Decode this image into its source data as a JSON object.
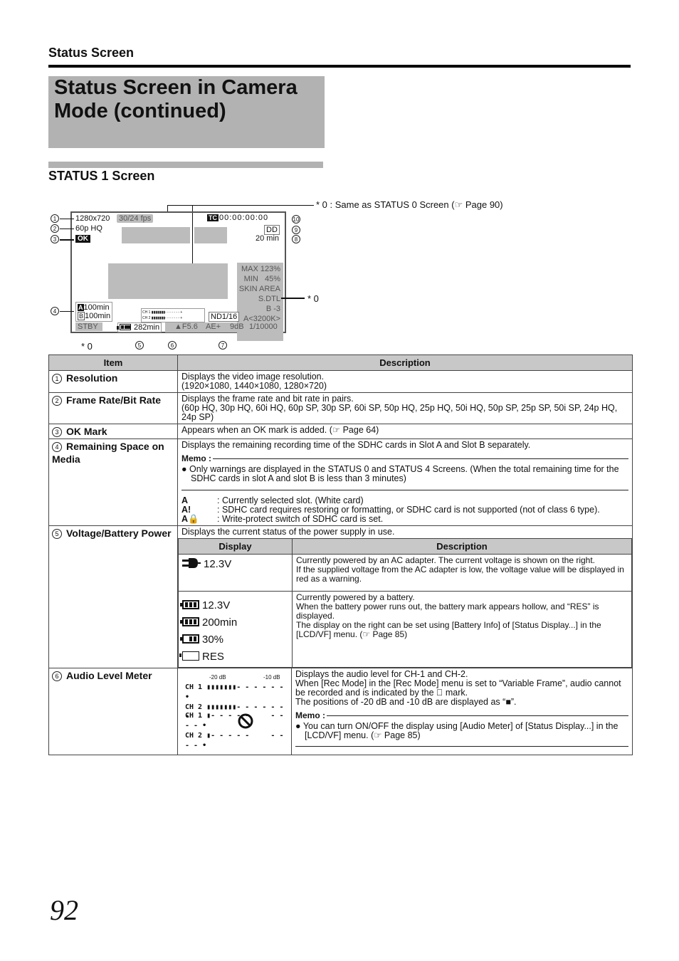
{
  "header": {
    "section": "Status Screen",
    "title": "Status Screen in Camera Mode (continued)",
    "subtitle": "STATUS 1 Screen"
  },
  "diagram": {
    "note": "* 0 : Same as STATUS 0 Screen (☞ Page 90)",
    "star0": "* 0",
    "resolution": "1280x720",
    "fps": "30/24 fps",
    "frame_rate": "60p HQ",
    "ok": "OK",
    "timecode_icon": "TC",
    "timecode": "00:00:00:00",
    "dd": "DD",
    "rec_time": "20 min",
    "zebra": [
      "MAX 123%",
      "MIN   45%",
      "SKIN AREA",
      "S.DTL",
      "B -3"
    ],
    "wb": "A<3200K>",
    "slot_a": "100min",
    "slot_b": "100min",
    "slot_a_label": "A",
    "slot_b_label": "B",
    "stby": "STBY",
    "battery": "282min",
    "iris": "▲F5.6",
    "ae": "AE+",
    "gain": "9dB",
    "shutter": "1/10000",
    "nd": "ND1/16",
    "ch1": "CH 1",
    "ch2": "CH 2",
    "callouts": [
      "1",
      "2",
      "3",
      "4",
      "5",
      "6",
      "7",
      "8",
      "9",
      "10"
    ]
  },
  "table": {
    "headers": [
      "Item",
      "Description"
    ],
    "rows": [
      {
        "num": "1",
        "item": "Resolution",
        "desc": [
          "Displays the video image resolution.",
          "(1920×1080, 1440×1080, 1280×720)"
        ]
      },
      {
        "num": "2",
        "item": "Frame Rate/Bit Rate",
        "desc": [
          "Displays the frame rate and bit rate in pairs.",
          "(60p HQ, 30p HQ, 60i HQ, 60p SP, 30p SP, 60i SP, 50p HQ, 25p HQ, 50i HQ, 50p SP, 25p SP, 50i SP, 24p HQ, 24p SP)"
        ]
      },
      {
        "num": "3",
        "item": "OK Mark",
        "desc": [
          "Appears when an OK mark is added. (☞ Page 64)"
        ]
      },
      {
        "num": "4",
        "item": "Remaining Space on Media",
        "desc": [
          "Displays the remaining recording time of the SDHC cards in Slot A and Slot B separately."
        ],
        "memo_label": "Memo :",
        "memo": "Only warnings are displayed in the STATUS 0 and STATUS 4 Screens. (When the total remaining time for the SDHC cards in slot A and slot B is less than 3 minutes)",
        "slots": [
          {
            "glyph": "A",
            "text": ": Currently selected slot. (White card)"
          },
          {
            "glyph": "A!",
            "text": ": SDHC card requires restoring or formatting, or SDHC card is not supported (not of class 6 type)."
          },
          {
            "glyph": "A🔒",
            "text": ": Write-protect switch of SDHC card is set."
          }
        ]
      },
      {
        "num": "5",
        "item": "Voltage/Battery Power",
        "desc": [
          "Displays the current status of the power supply in use."
        ],
        "sub_headers": [
          "Display",
          "Description"
        ],
        "sub_rows": [
          {
            "displays": [
              "12.3V"
            ],
            "icon": "ac-adapter-icon",
            "text": [
              "Currently powered by an AC adapter. The current voltage is shown on the right.",
              "If the supplied voltage from the AC adapter is low, the voltage value will be displayed in red as a warning."
            ]
          },
          {
            "displays": [
              "12.3V",
              "200min",
              "30%",
              "RES"
            ],
            "icon": "battery-icon",
            "text": [
              "Currently powered by a battery.",
              "When the battery power runs out, the battery mark appears hollow, and “RES” is displayed.",
              "The display on the right can be set using [Battery Info] of [Status Display...] in the [LCD/VF] menu. (☞ Page 85)"
            ]
          }
        ]
      },
      {
        "num": "6",
        "item": "Audio Level Meter",
        "meter": {
          "m20": "-20 dB",
          "m10": "-10 dB",
          "ch1": "CH 1",
          "ch2": "CH 2"
        },
        "desc": [
          "Displays the audio level for CH-1 and CH-2.",
          "When [Rec Mode] in the [Rec Mode] menu is set to “Variable Frame”, audio cannot be recorded and is indicated by the ⃠ mark.",
          "The positions of -20 dB and -10 dB are displayed as “■”."
        ],
        "memo_label": "Memo :",
        "memo": "You can turn ON/OFF the display using [Audio Meter] of [Status Display...] in the [LCD/VF] menu. (☞ Page 85)"
      }
    ]
  },
  "page_number": "92"
}
